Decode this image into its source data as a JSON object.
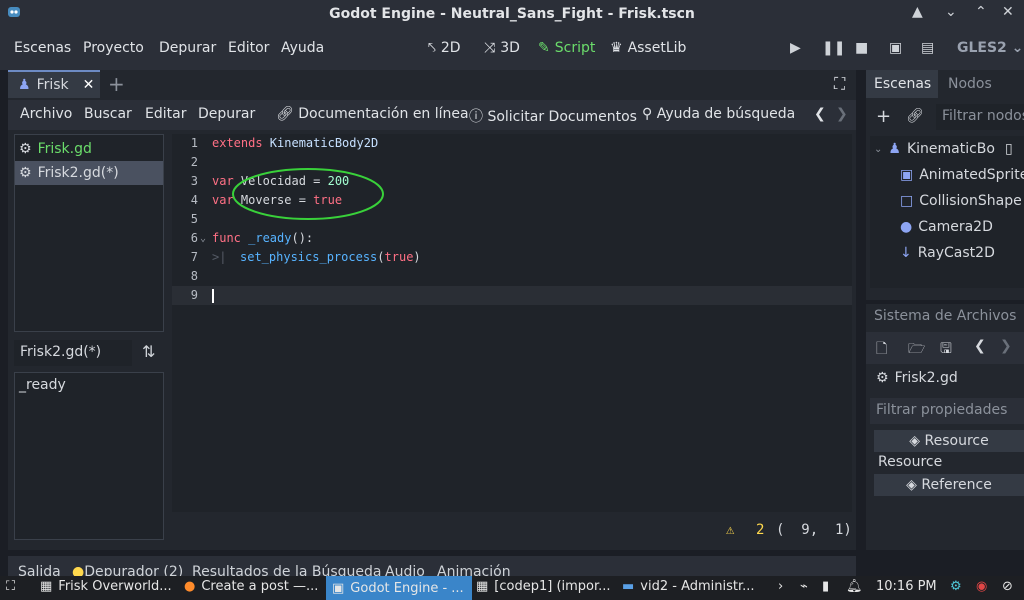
{
  "window": {
    "title": "Godot Engine - Neutral_Sans_Fight - Frisk.tscn"
  },
  "menu": {
    "items": [
      "Escenas",
      "Proyecto",
      "Depurar",
      "Editor",
      "Ayuda"
    ],
    "workspaces": [
      "2D",
      "3D",
      "Script",
      "AssetLib"
    ],
    "renderer": "GLES2"
  },
  "scene_tab": {
    "label": "Frisk"
  },
  "script_menu": {
    "items": [
      "Archivo",
      "Buscar",
      "Editar",
      "Depurar",
      "Documentación en línea",
      "Solicitar Documentos",
      "Ayuda de búsqueda"
    ]
  },
  "script_list": {
    "items": [
      "Frisk.gd",
      "Frisk2.gd(*)"
    ],
    "current_filter": "Frisk2.gd(*)",
    "members": [
      "_ready"
    ]
  },
  "code": {
    "lines": [
      {
        "n": "1",
        "t": [
          "extends ",
          "KinematicBody2D"
        ]
      },
      {
        "n": "2",
        "t": [
          ""
        ]
      },
      {
        "n": "3",
        "t": [
          "var ",
          "Velocidad = ",
          "200"
        ]
      },
      {
        "n": "4",
        "t": [
          "var ",
          "Moverse = ",
          "true"
        ]
      },
      {
        "n": "5",
        "t": [
          ""
        ]
      },
      {
        "n": "6",
        "t": [
          "func ",
          "_ready",
          "():"
        ]
      },
      {
        "n": "7",
        "t": [
          "set_physics_process",
          "(",
          "true",
          ")"
        ]
      },
      {
        "n": "8",
        "t": [
          ""
        ]
      },
      {
        "n": "9",
        "t": [
          ""
        ]
      }
    ]
  },
  "status": {
    "warnings": "2",
    "position": "(  9,  1)"
  },
  "bottom_tabs": [
    "Salida",
    "Depurador (2)",
    "Resultados de la Búsqueda",
    "Audio",
    "Animación"
  ],
  "scene_dock": {
    "tabs": [
      "Escenas",
      "Nodos"
    ],
    "filter_placeholder": "Filtrar nodos",
    "nodes": [
      "KinematicBo",
      "AnimatedSprite",
      "CollisionShape",
      "Camera2D",
      "RayCast2D"
    ]
  },
  "filesystem_dock": {
    "title": "Sistema de Archivos",
    "current_file": "Frisk2.gd",
    "filter_placeholder": "Filtrar propiedades",
    "resource_btn": "Resource",
    "resource_label": "Resource",
    "reference_btn": "Reference"
  },
  "taskbar": {
    "items": [
      "Frisk Overworld...",
      "Create a post —...",
      "Godot Engine - ...",
      "[codep1] (impor...",
      "vid2 - Administr..."
    ],
    "clock": "10:16 PM"
  },
  "colors": {
    "accent_green": "#6bdd6b",
    "highlight_circle": "#39d13a",
    "warning_yellow": "#ffd84d"
  }
}
